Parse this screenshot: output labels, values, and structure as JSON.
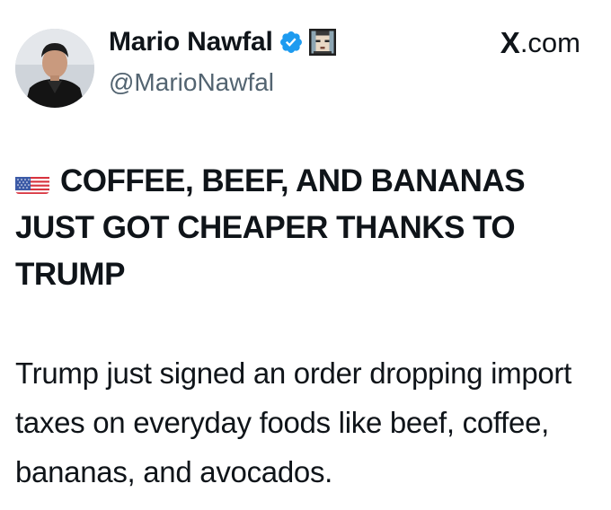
{
  "author": {
    "display_name": "Mario Nawfal",
    "handle": "@MarioNawfal",
    "verified_icon": "verified-badge-icon",
    "badge_icon": "nft-pixel-avatar-icon",
    "avatar_icon": "profile-photo"
  },
  "source": {
    "x_mark": "X",
    "domain": ".com"
  },
  "post": {
    "flag_icon": "us-flag-emoji",
    "headline": "COFFEE, BEEF, AND BANANAS JUST GOT CHEAPER THANKS TO TRUMP",
    "body": "Trump just signed an order dropping import taxes on everyday foods like beef, coffee, bananas, and avocados."
  },
  "colors": {
    "text": "#0f1419",
    "secondary_text": "#536471",
    "verified_blue": "#1d9bf0",
    "background": "#ffffff"
  }
}
